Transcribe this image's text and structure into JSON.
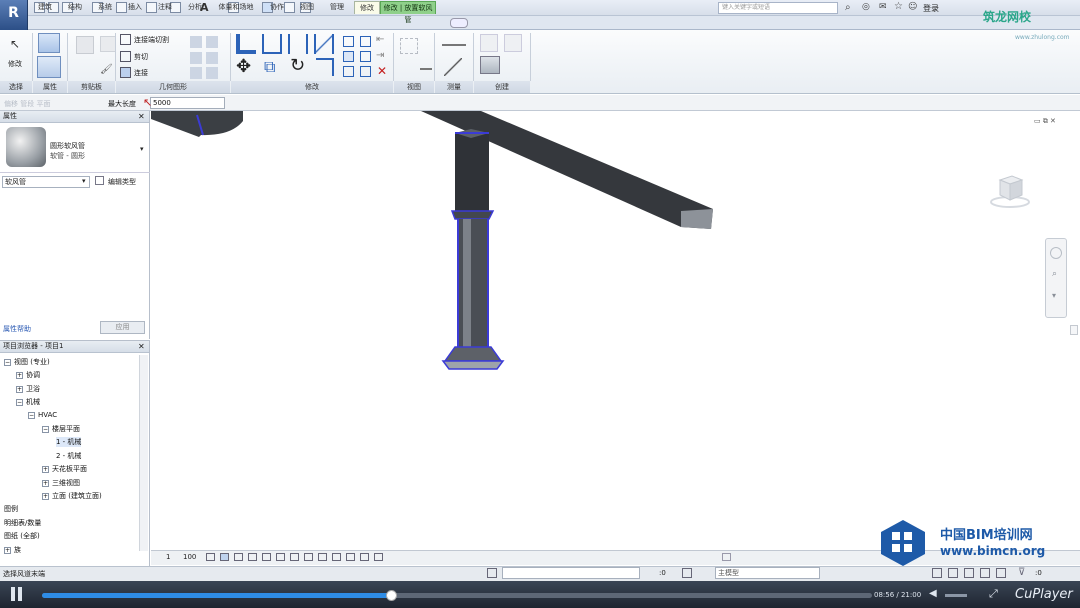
{
  "app": {
    "logo_letter": "R"
  },
  "quick_access": {
    "search_placeholder": "键入关键字或短语",
    "login_label": "登录"
  },
  "tabs": [
    {
      "label": "建筑"
    },
    {
      "label": "结构"
    },
    {
      "label": "系统"
    },
    {
      "label": "插入"
    },
    {
      "label": "注释"
    },
    {
      "label": "分析"
    },
    {
      "label": "体量和场地"
    },
    {
      "label": "协作"
    },
    {
      "label": "视图"
    },
    {
      "label": "管理"
    },
    {
      "label": "修改"
    },
    {
      "label": "修改 | 放置软风管"
    }
  ],
  "ribbon": {
    "modify_label": "修改",
    "small_buttons": [
      "连接端切割",
      "剪切",
      "连接"
    ],
    "panels": [
      "选择",
      "属性",
      "剪贴板",
      "几何图形",
      "修改",
      "视图",
      "测量",
      "创建"
    ]
  },
  "options_bar": {
    "ghost_text": "偏移  管段 平面",
    "max_length_label": "最大长度",
    "max_length_value": "5000"
  },
  "properties": {
    "title": "属性",
    "type_name": "圆形软风管",
    "type_sub": "软管 - 圆形",
    "instance_selector": "软风管",
    "edit_type": "编辑类型",
    "help_link": "属性帮助",
    "apply": "应用"
  },
  "browser": {
    "title": "项目浏览器 - 项目1",
    "nodes": [
      {
        "label": "视图 (专业)",
        "depth": 0,
        "expander": "−"
      },
      {
        "label": "协调",
        "depth": 1,
        "expander": "+"
      },
      {
        "label": "卫浴",
        "depth": 1,
        "expander": "+"
      },
      {
        "label": "机械",
        "depth": 1,
        "expander": "−"
      },
      {
        "label": "HVAC",
        "depth": 2,
        "expander": "−"
      },
      {
        "label": "楼层平面",
        "depth": 3,
        "expander": "−"
      },
      {
        "label": "1 - 机械",
        "depth": 4,
        "expander": "",
        "selected": true
      },
      {
        "label": "2 - 机械",
        "depth": 4,
        "expander": ""
      },
      {
        "label": "天花板平面",
        "depth": 3,
        "expander": "+"
      },
      {
        "label": "三维视图",
        "depth": 3,
        "expander": "+"
      },
      {
        "label": "立面 (建筑立面)",
        "depth": 3,
        "expander": "+"
      },
      {
        "label": "图例",
        "depth": 0,
        "expander": ""
      },
      {
        "label": "明细表/数量",
        "depth": 0,
        "expander": ""
      },
      {
        "label": "图纸 (全部)",
        "depth": 0,
        "expander": ""
      },
      {
        "label": "族",
        "depth": 0,
        "expander": "+"
      }
    ]
  },
  "view_control": {
    "scale_a": "1",
    "scale_b": "100"
  },
  "status": {
    "text": "选择风道末端",
    "zero": ":0",
    "view_field": "主模型",
    "filter_count": ":0"
  },
  "player": {
    "time": "08:56 / 21:00",
    "brand": "CuPlayer",
    "progress_fraction": 0.42
  },
  "watermarks": {
    "zl_logo": "筑龙网校",
    "zl_sub": "www.zhulong.com",
    "bim_cn": "中国BIM培训网",
    "bim_url": "www.bimcn.org"
  },
  "colors": {
    "accent": "#2e8ce6",
    "context_tab": "#8fd08a",
    "duct_highlight": "#3b3bd6"
  }
}
